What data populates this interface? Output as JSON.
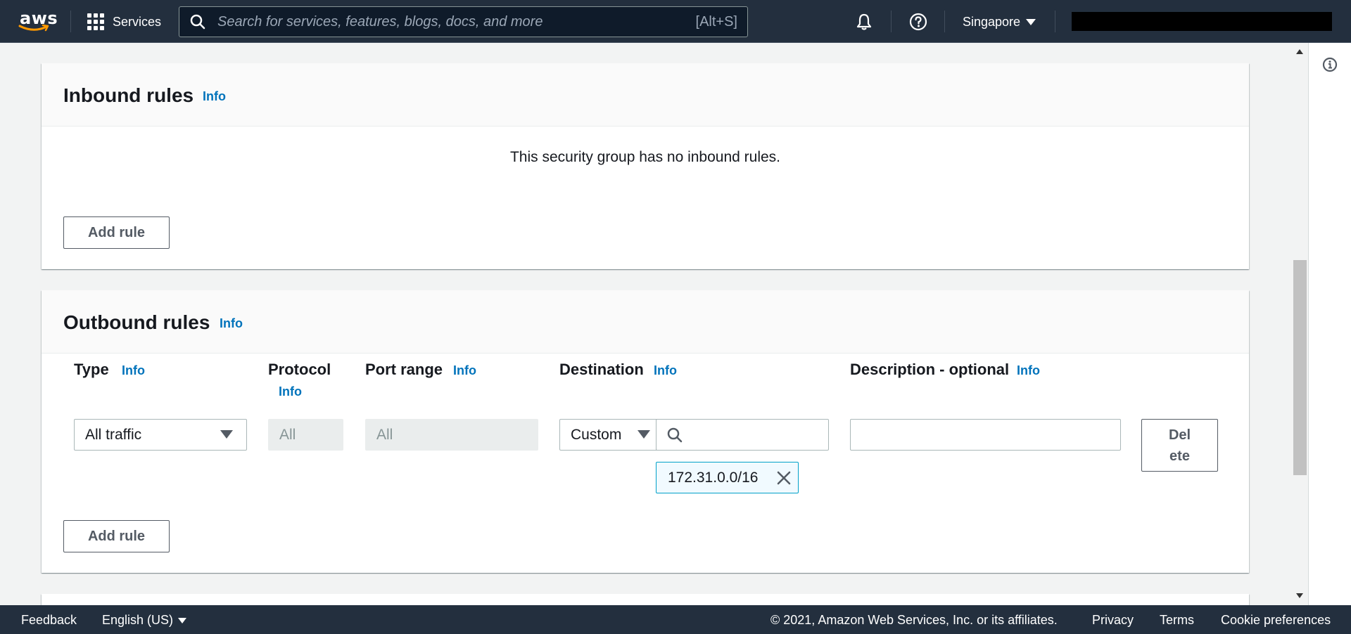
{
  "topnav": {
    "logo_text": "aws",
    "services_label": "Services",
    "search_placeholder": "Search for services, features, blogs, docs, and more",
    "search_shortcut": "[Alt+S]",
    "region": "Singapore"
  },
  "inbound": {
    "title": "Inbound rules",
    "info": "Info",
    "empty_message": "This security group has no inbound rules.",
    "add_rule": "Add rule"
  },
  "outbound": {
    "title": "Outbound rules",
    "info": "Info",
    "columns": {
      "type": {
        "label": "Type",
        "info": "Info"
      },
      "protocol": {
        "label": "Protocol",
        "info": "Info"
      },
      "port_range": {
        "label": "Port range",
        "info": "Info"
      },
      "destination": {
        "label": "Destination",
        "info": "Info"
      },
      "description": {
        "label": "Description - optional",
        "info": "Info"
      }
    },
    "rule": {
      "type_value": "All traffic",
      "protocol_value": "All",
      "port_range_value": "All",
      "destination_mode": "Custom",
      "destination_search": "",
      "destination_token": "172.31.0.0/16",
      "description_value": "",
      "delete_label_line1": "Del",
      "delete_label_line2": "ete"
    },
    "add_rule": "Add rule"
  },
  "footer": {
    "feedback": "Feedback",
    "language": "English (US)",
    "copyright": "© 2021, Amazon Web Services, Inc. or its affiliates.",
    "privacy": "Privacy",
    "terms": "Terms",
    "cookie": "Cookie preferences"
  },
  "colors": {
    "nav_bg": "#232f3e",
    "link": "#0073bb",
    "token_border": "#00a1c9",
    "token_bg": "#f1faff"
  }
}
